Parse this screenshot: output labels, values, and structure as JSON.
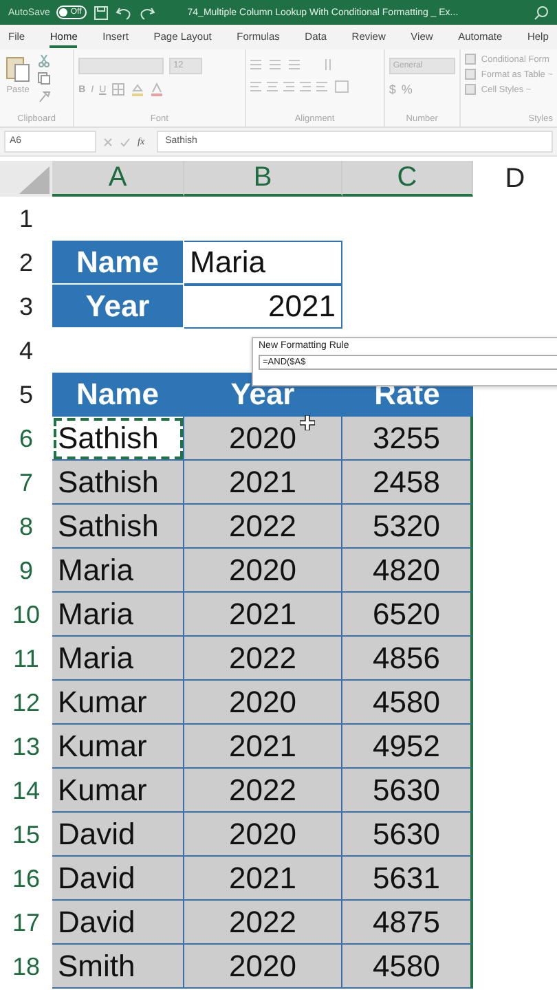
{
  "title_bar": {
    "autosave_label": "AutoSave",
    "autosave_on": false,
    "autosave_state": "Off",
    "title": "74_Multiple Column Lookup With Conditional Formatting _ Ex..."
  },
  "menu_tabs": [
    {
      "label": "File",
      "selected": false
    },
    {
      "label": "Home",
      "selected": true
    },
    {
      "label": "Insert",
      "selected": false
    },
    {
      "label": "Page Layout",
      "selected": false
    },
    {
      "label": "Formulas",
      "selected": false
    },
    {
      "label": "Data",
      "selected": false
    },
    {
      "label": "Review",
      "selected": false
    },
    {
      "label": "View",
      "selected": false
    },
    {
      "label": "Automate",
      "selected": false
    },
    {
      "label": "Help",
      "selected": false
    }
  ],
  "ribbon": {
    "disabled": true,
    "paste_label": "Paste",
    "font_size": "12",
    "font_buttons": [
      "B",
      "I",
      "U"
    ],
    "number_format": "General",
    "number_symbols": [
      "$",
      "%"
    ],
    "styles": [
      "Conditional Form",
      "Format as Table ~",
      "Cell Styles ~"
    ],
    "groups": [
      "Clipboard",
      "Font",
      "Alignment",
      "Number",
      "Styles"
    ]
  },
  "formula_bar": {
    "cell_ref": "A6",
    "function_label": "fx",
    "value": "Sathish"
  },
  "columns": [
    {
      "label": "A",
      "selected": true
    },
    {
      "label": "B",
      "selected": true
    },
    {
      "label": "C",
      "selected": true
    },
    {
      "label": "D",
      "selected": false
    }
  ],
  "rows": [
    {
      "number": "1",
      "selected": false,
      "kind": "blank"
    },
    {
      "number": "2",
      "selected": false,
      "kind": "input",
      "cells": [
        {
          "text": "Name",
          "kind": "label"
        },
        {
          "text": "Maria",
          "kind": "text"
        }
      ]
    },
    {
      "number": "3",
      "selected": false,
      "kind": "input",
      "cells": [
        {
          "text": "Year",
          "kind": "label"
        },
        {
          "text": "2021",
          "kind": "number"
        }
      ]
    },
    {
      "number": "4",
      "selected": false,
      "kind": "blank"
    },
    {
      "number": "5",
      "selected": false,
      "kind": "header",
      "cells": [
        {
          "text": "Name"
        },
        {
          "text": "Year"
        },
        {
          "text": "Rate"
        }
      ]
    },
    {
      "number": "6",
      "selected": true,
      "kind": "data",
      "cells": [
        {
          "text": "Sathish",
          "marquee": true
        },
        {
          "text": "2020",
          "marquee": false
        },
        {
          "text": "3255",
          "marquee": false
        }
      ]
    },
    {
      "number": "7",
      "selected": true,
      "kind": "data",
      "cells": [
        {
          "text": "Sathish",
          "marquee": false
        },
        {
          "text": "2021",
          "marquee": false
        },
        {
          "text": "2458",
          "marquee": false
        }
      ]
    },
    {
      "number": "8",
      "selected": true,
      "kind": "data",
      "cells": [
        {
          "text": "Sathish",
          "marquee": false
        },
        {
          "text": "2022",
          "marquee": false
        },
        {
          "text": "5320",
          "marquee": false
        }
      ]
    },
    {
      "number": "9",
      "selected": true,
      "kind": "data",
      "cells": [
        {
          "text": "Maria",
          "marquee": false
        },
        {
          "text": "2020",
          "marquee": false
        },
        {
          "text": "4820",
          "marquee": false
        }
      ]
    },
    {
      "number": "10",
      "selected": true,
      "kind": "data",
      "cells": [
        {
          "text": "Maria",
          "marquee": false
        },
        {
          "text": "2021",
          "marquee": false
        },
        {
          "text": "6520",
          "marquee": false
        }
      ]
    },
    {
      "number": "11",
      "selected": true,
      "kind": "data",
      "cells": [
        {
          "text": "Maria",
          "marquee": false
        },
        {
          "text": "2022",
          "marquee": false
        },
        {
          "text": "4856",
          "marquee": false
        }
      ]
    },
    {
      "number": "12",
      "selected": true,
      "kind": "data",
      "cells": [
        {
          "text": "Kumar",
          "marquee": false
        },
        {
          "text": "2020",
          "marquee": false
        },
        {
          "text": "4580",
          "marquee": false
        }
      ]
    },
    {
      "number": "13",
      "selected": true,
      "kind": "data",
      "cells": [
        {
          "text": "Kumar",
          "marquee": false
        },
        {
          "text": "2021",
          "marquee": false
        },
        {
          "text": "4952",
          "marquee": false
        }
      ]
    },
    {
      "number": "14",
      "selected": true,
      "kind": "data",
      "cells": [
        {
          "text": "Kumar",
          "marquee": false
        },
        {
          "text": "2022",
          "marquee": false
        },
        {
          "text": "5630",
          "marquee": false
        }
      ]
    },
    {
      "number": "15",
      "selected": true,
      "kind": "data",
      "cells": [
        {
          "text": "David",
          "marquee": false
        },
        {
          "text": "2020",
          "marquee": false
        },
        {
          "text": "5630",
          "marquee": false
        }
      ]
    },
    {
      "number": "16",
      "selected": true,
      "kind": "data",
      "cells": [
        {
          "text": "David",
          "marquee": false
        },
        {
          "text": "2021",
          "marquee": false
        },
        {
          "text": "5631",
          "marquee": false
        }
      ]
    },
    {
      "number": "17",
      "selected": true,
      "kind": "data",
      "cells": [
        {
          "text": "David",
          "marquee": false
        },
        {
          "text": "2022",
          "marquee": false
        },
        {
          "text": "4875",
          "marquee": false
        }
      ]
    },
    {
      "number": "18",
      "selected": true,
      "kind": "data",
      "cells": [
        {
          "text": "Smith",
          "marquee": false
        },
        {
          "text": "2020",
          "marquee": false
        },
        {
          "text": "4580",
          "marquee": false
        }
      ]
    }
  ],
  "dialog": {
    "title": "New Formatting Rule",
    "formula": "=AND($A$"
  }
}
